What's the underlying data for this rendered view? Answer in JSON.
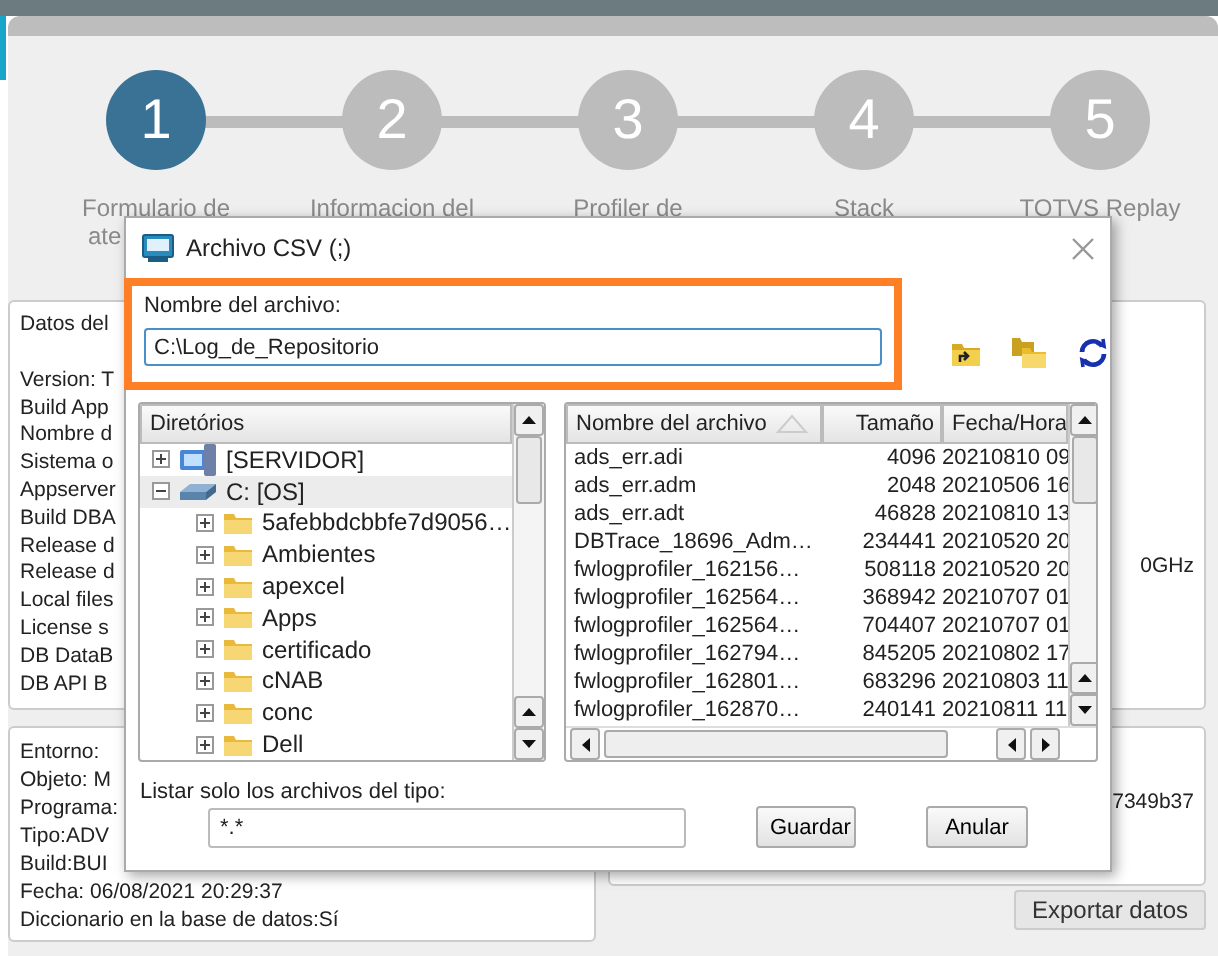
{
  "steps": [
    {
      "number": "1",
      "lines": [
        "Formulario de",
        "ate"
      ],
      "selected": true
    },
    {
      "number": "2",
      "lines": [
        "Informacion del"
      ],
      "selected": false
    },
    {
      "number": "3",
      "lines": [
        "Profiler de"
      ],
      "selected": false
    },
    {
      "number": "4",
      "lines": [
        "Stack"
      ],
      "selected": false
    },
    {
      "number": "5",
      "lines": [
        "TOTVS Replay"
      ],
      "selected": false
    }
  ],
  "system_panel": {
    "lines": [
      "Datos del",
      "Version: T",
      "Build App",
      "Nombre d",
      "Sistema o",
      "Appserver",
      "Build DBA",
      "Release d",
      "Release d",
      "Local files",
      "License s",
      "DB DataB",
      "DB API B"
    ]
  },
  "environment_panel": {
    "lines": [
      "Entorno:",
      "Objeto: M",
      "Programa:",
      "Tipo:ADV",
      "Build:BUI",
      "Fecha: 06/08/2021 20:29:37",
      "Diccionario en la base de datos:Sí"
    ]
  },
  "hardware_panel": {
    "lines": [
      "0GHz"
    ]
  },
  "hash_panel": {
    "lines": [
      "7349b37"
    ]
  },
  "export_button": "Exportar datos",
  "dialog": {
    "title": "Archivo CSV (;)",
    "file_name_label": "Nombre del archivo:",
    "file_name_value": "C:\\Log_de_Repositorio",
    "tree": {
      "header": "Diretórios",
      "items": [
        {
          "label": "[SERVIDOR]",
          "kind": "server",
          "expanded": false,
          "selected": false
        },
        {
          "label": "C: [OS]",
          "kind": "drive",
          "expanded": true,
          "selected": true,
          "children": [
            {
              "label": "5afebbdcbbfe7d9056…",
              "kind": "folder",
              "expanded": false,
              "selected": false
            },
            {
              "label": "Ambientes",
              "kind": "folder",
              "expanded": false,
              "selected": false
            },
            {
              "label": "apexcel",
              "kind": "folder",
              "expanded": false,
              "selected": false
            },
            {
              "label": "Apps",
              "kind": "folder",
              "expanded": false,
              "selected": false
            },
            {
              "label": "certificado",
              "kind": "folder",
              "expanded": false,
              "selected": false
            },
            {
              "label": "cNAB",
              "kind": "folder",
              "expanded": false,
              "selected": false
            },
            {
              "label": "conc",
              "kind": "folder",
              "expanded": false,
              "selected": false
            },
            {
              "label": "Dell",
              "kind": "folder",
              "expanded": false,
              "selected": false
            }
          ]
        }
      ]
    },
    "files": {
      "columns": [
        "Nombre del archivo",
        "Tamaño",
        "Fecha/Hora"
      ],
      "rows": [
        [
          "ads_err.adi",
          "4096",
          "20210810 09"
        ],
        [
          "ads_err.adm",
          "2048",
          "20210506 16"
        ],
        [
          "ads_err.adt",
          "46828",
          "20210810 13"
        ],
        [
          "DBTrace_18696_Adm…",
          "234441",
          "20210520 20"
        ],
        [
          "fwlogprofiler_162156…",
          "508118",
          "20210520 20"
        ],
        [
          "fwlogprofiler_162564…",
          "368942",
          "20210707 01"
        ],
        [
          "fwlogprofiler_162564…",
          "704407",
          "20210707 01"
        ],
        [
          "fwlogprofiler_162794…",
          "845205",
          "20210802 17"
        ],
        [
          "fwlogprofiler_162801…",
          "683296",
          "20210803 11"
        ],
        [
          "fwlogprofiler_162870…",
          "240141",
          "20210811 11"
        ]
      ]
    },
    "filter_label": "Listar solo los archivos del tipo:",
    "filter_value": "*.*",
    "buttons": [
      "Guardar",
      "Anular"
    ]
  }
}
